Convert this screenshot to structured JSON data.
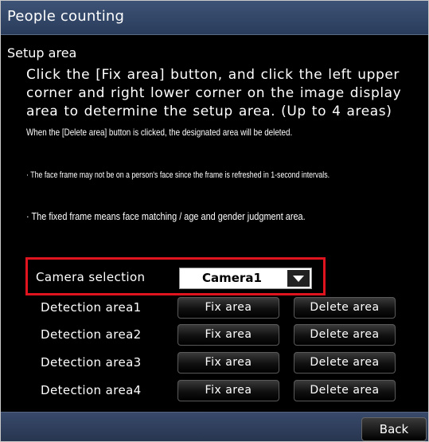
{
  "window": {
    "title": "People counting"
  },
  "setup": {
    "label": "Setup area",
    "instruction": "Click the [Fix area] button, and click the left upper corner and right lower corner on the image display area to determine the setup area. (Up to 4 areas)",
    "delete_note": "When the [Delete area] button is clicked, the designated area will be deleted.",
    "note1": "· The face frame may not be on a person's face since the frame is refreshed in 1-second intervals.",
    "note2": "· The fixed frame means face matching / age and gender judgment area."
  },
  "camera": {
    "label": "Camera selection",
    "selected": "Camera1",
    "dropdown_icon": "triangle-down-icon"
  },
  "areas": [
    {
      "label": "Detection area1",
      "fix_label": "Fix area",
      "delete_label": "Delete area"
    },
    {
      "label": "Detection area2",
      "fix_label": "Fix area",
      "delete_label": "Delete area"
    },
    {
      "label": "Detection area3",
      "fix_label": "Fix area",
      "delete_label": "Delete area"
    },
    {
      "label": "Detection area4",
      "fix_label": "Fix area",
      "delete_label": "Delete area"
    }
  ],
  "footer": {
    "back_label": "Back"
  },
  "colors": {
    "title_bar": "#2f4262",
    "highlight": "#e0141e",
    "background": "#000000"
  }
}
